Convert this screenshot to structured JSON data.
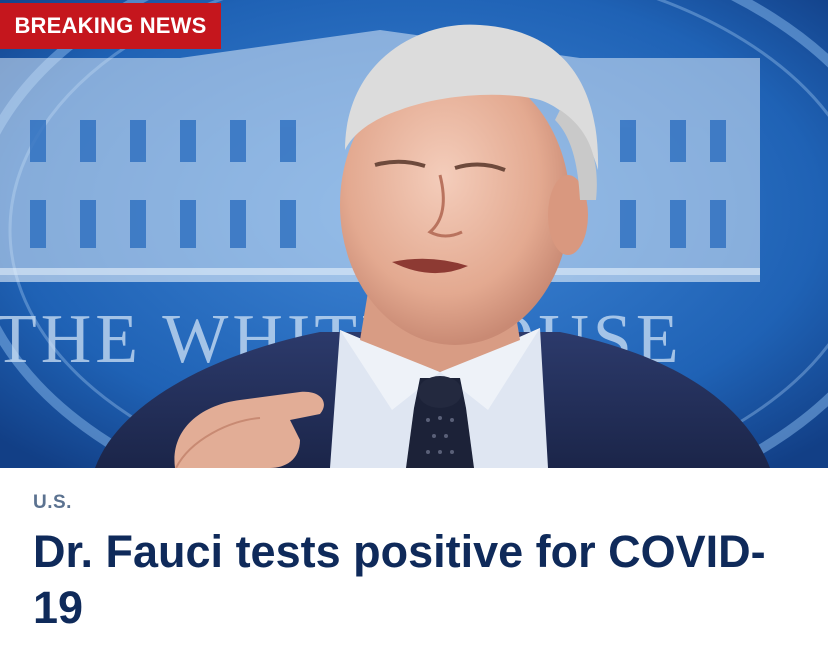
{
  "badge": {
    "label": "BREAKING NEWS",
    "color": "#c5161d"
  },
  "hero": {
    "backdrop_lettering": "THE WHITE HOUSE",
    "alt": "photo"
  },
  "article": {
    "category": "U.S.",
    "headline": "Dr. Fauci tests positive for COVID-19"
  },
  "colors": {
    "headline": "#0f2a5a",
    "category": "#5b7290",
    "backdrop_blue": "#1d5fb0"
  }
}
